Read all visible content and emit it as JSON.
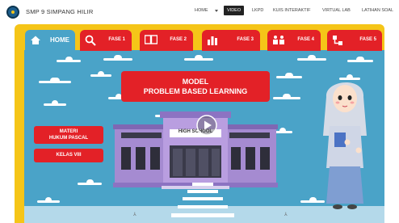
{
  "site": {
    "name": "SMP 9 SIMPANG HILIR"
  },
  "nav": [
    "HOME",
    "VIDEO",
    "LKPD",
    "KUIS INTERAKTIF",
    "VIRTUAL LAB",
    "LATIHAN SOAL"
  ],
  "tabs": [
    "HOME",
    "FASE 1",
    "FASE 2",
    "FASE 3",
    "FASE 4",
    "FASE 5"
  ],
  "title": {
    "line1": "MODEL",
    "line2": "PROBLEM BASED LEARNING"
  },
  "side": {
    "materi_line1": "MATERI",
    "materi_line2": "HUKUM PASCAL",
    "kelas": "KELAS VIII"
  },
  "school_sign": "HIGH SCHOOL",
  "colors": {
    "board": "#f5c518",
    "sky": "#4aa3c8",
    "accent": "#e32127"
  },
  "icons": {
    "home": "house-icon",
    "fase1": "search-icon",
    "fase2": "book-icon",
    "fase3": "chart-icon",
    "fase4": "group-icon",
    "fase5": "flow-icon",
    "play": "play-icon"
  }
}
